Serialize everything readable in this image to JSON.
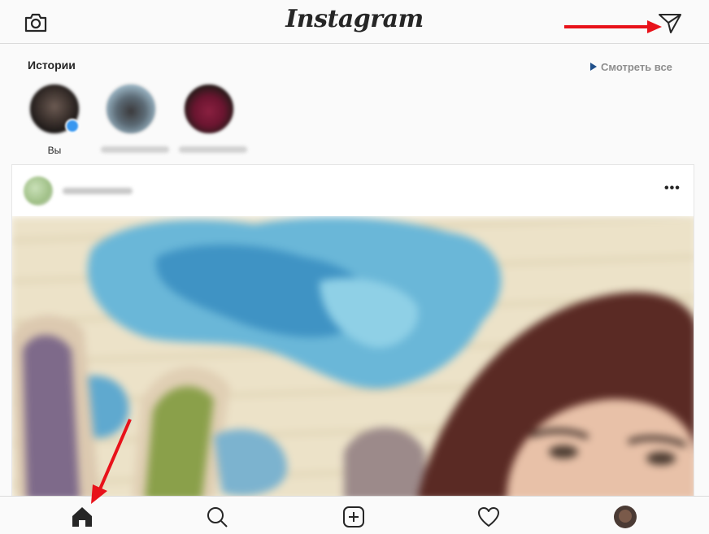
{
  "topbar": {
    "logo": "Instagram",
    "left_icon": "camera-icon",
    "right_icon": "direct-message-icon"
  },
  "stories": {
    "title": "Истории",
    "watch_all": "Смотреть все",
    "items": [
      {
        "label": "Вы"
      },
      {
        "label": ""
      },
      {
        "label": ""
      }
    ]
  },
  "post": {
    "more_icon": "more-options-icon",
    "more_label": "•••"
  },
  "bottom_nav": {
    "items": [
      "home-icon",
      "search-icon",
      "new-post-icon",
      "activity-heart-icon",
      "profile-avatar"
    ]
  },
  "annotations": {
    "arrow_color": "#e8121a"
  },
  "colors": {
    "accent_blue": "#3897f0",
    "text": "#262626",
    "muted": "#8e8e8e"
  }
}
